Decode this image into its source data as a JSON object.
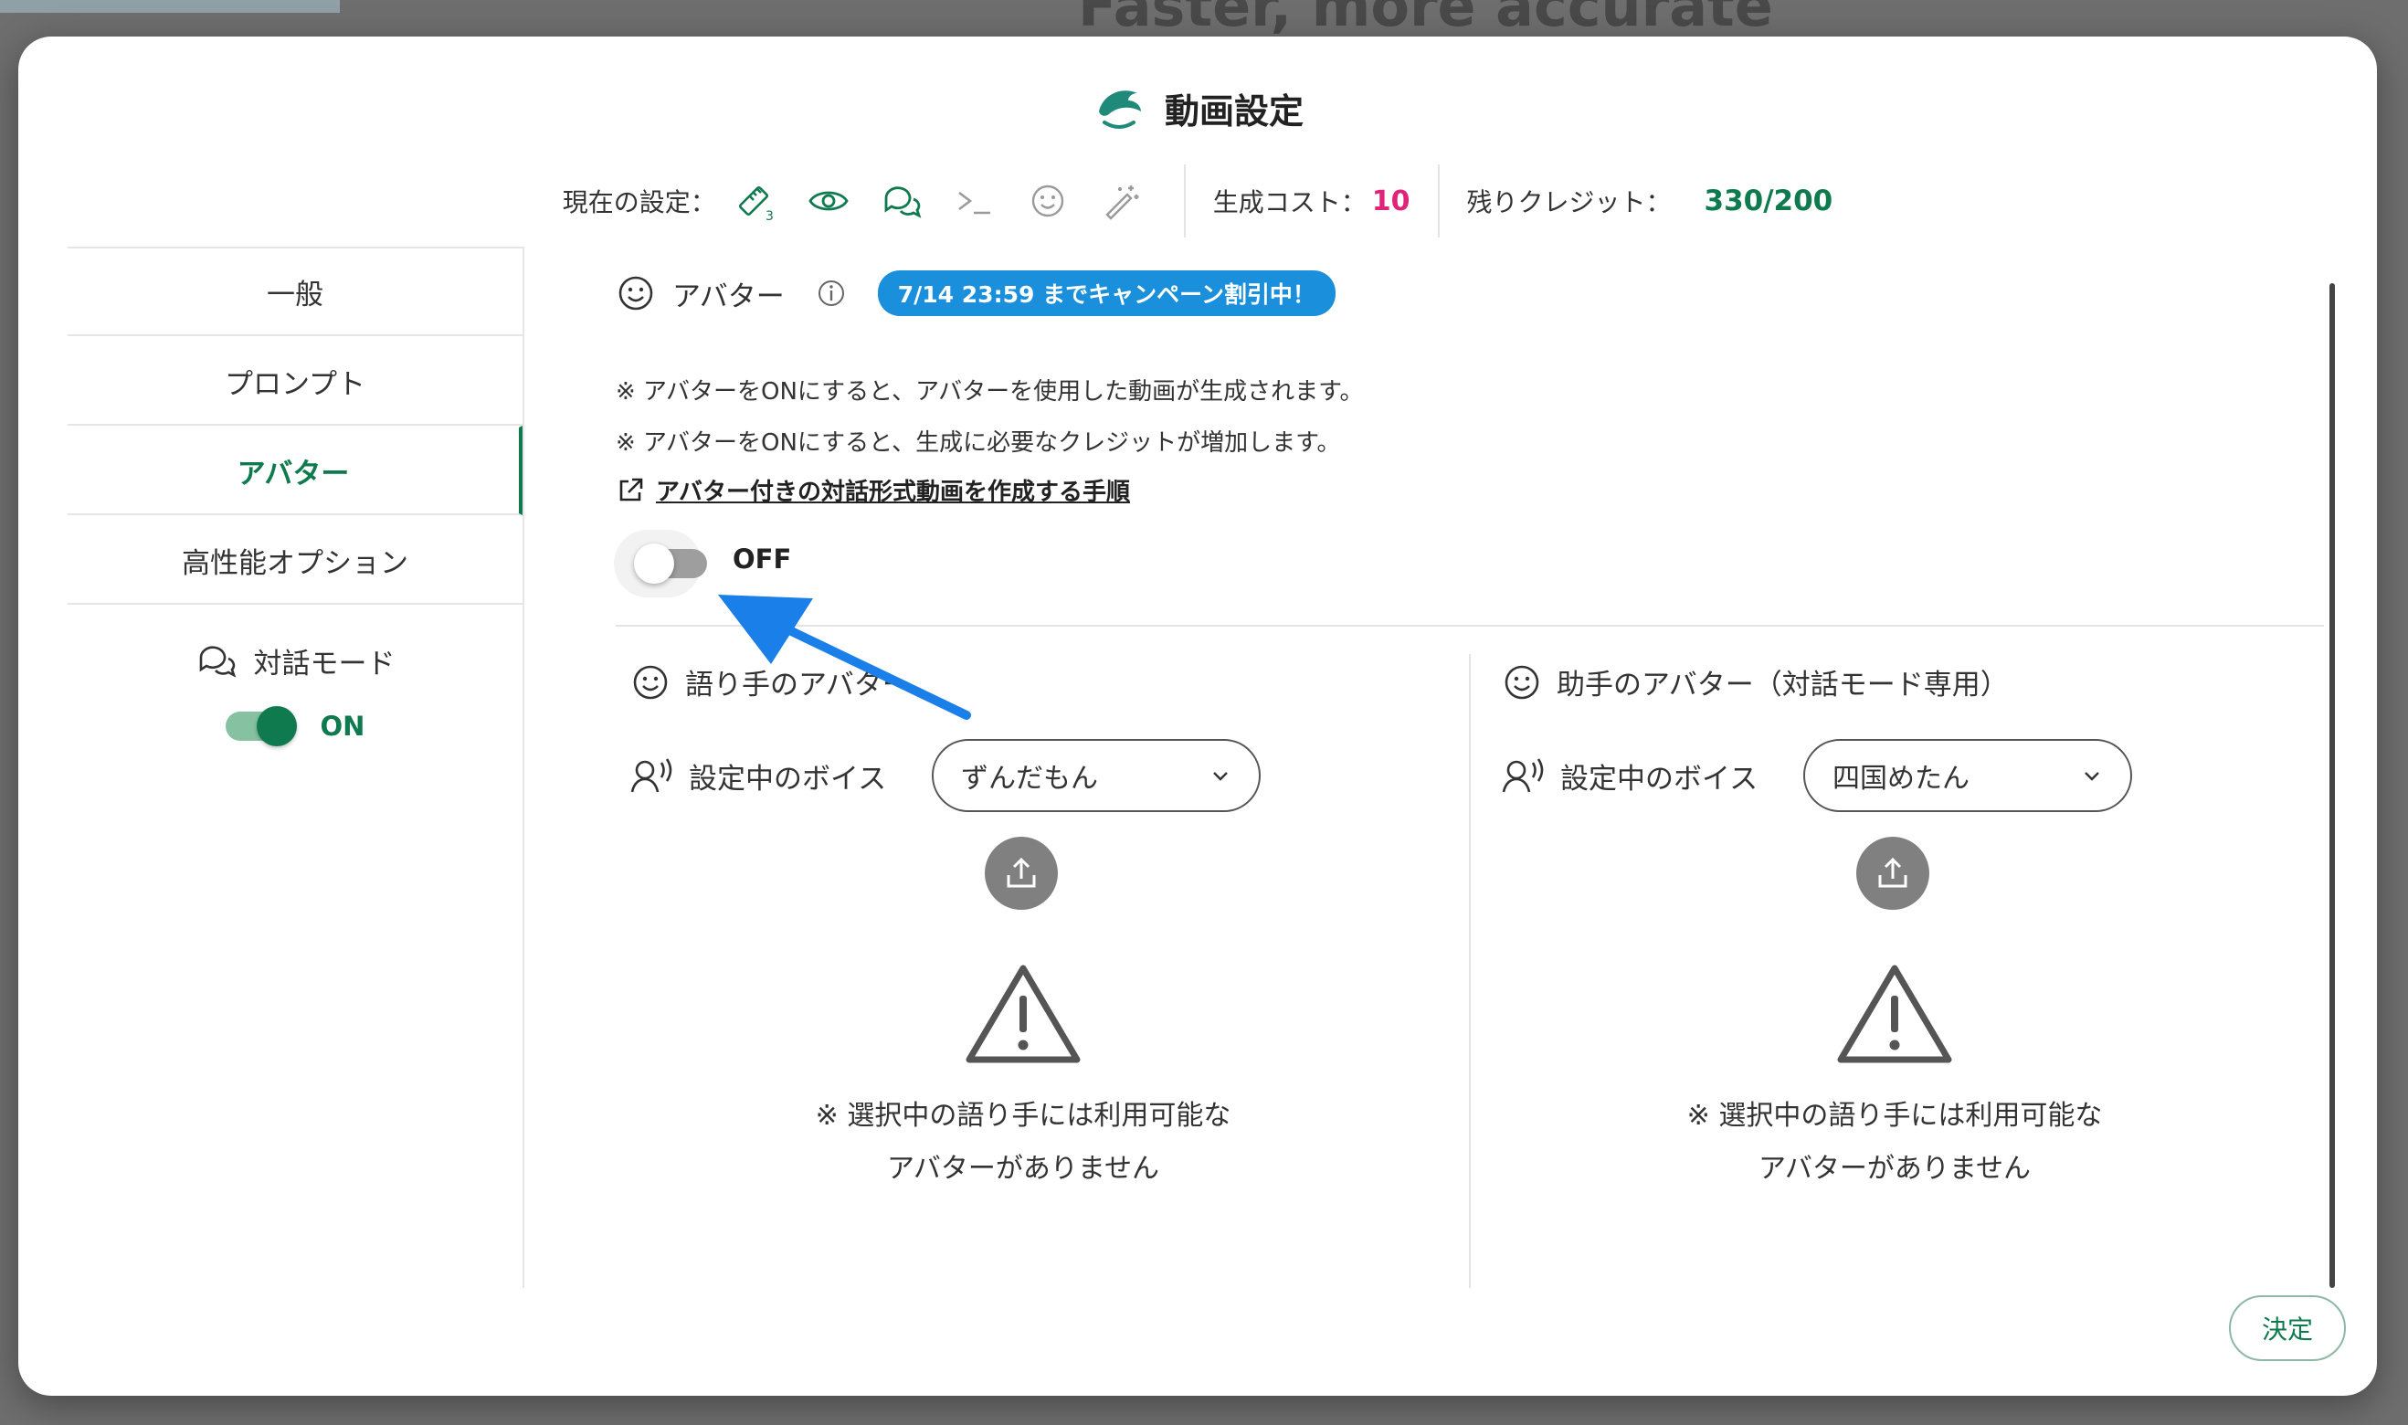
{
  "background": {
    "heading_text": "Faster, more accurate"
  },
  "header": {
    "title": "動画設定",
    "current_settings_label": "現在の設定：",
    "setting_icons": [
      "ruler-icon",
      "eye-icon",
      "chat-icon",
      "terminal-icon",
      "smiley-icon",
      "magic-wand-icon"
    ],
    "cost_label": "生成コスト：",
    "cost_value": "10",
    "credits_label": "残りクレジット：",
    "credits_value": "330/200"
  },
  "sidebar": {
    "items": [
      {
        "label": "一般",
        "active": false
      },
      {
        "label": "プロンプト",
        "active": false
      },
      {
        "label": "アバター",
        "active": true
      },
      {
        "label": "高性能オプション",
        "active": false
      }
    ],
    "dialog_mode_label": "対話モード",
    "dialog_mode_state": "ON"
  },
  "avatar": {
    "title": "アバター",
    "campaign_badge": "7/14 23:59 までキャンペーン割引中！",
    "note1": "※ アバターをONにすると、アバターを使用した動画が生成されます。",
    "note2": "※ アバターをONにすると、生成に必要なクレジットが増加します。",
    "guide_link": "アバター付きの対話形式動画を作成する手順",
    "toggle_state": "OFF"
  },
  "narrator": {
    "title": "語り手のアバター",
    "voice_label": "設定中のボイス",
    "voice_value": "ずんだもん",
    "warning_line1": "※ 選択中の語り手には利用可能な",
    "warning_line2": "アバターがありません"
  },
  "assistant": {
    "title": "助手のアバター（対話モード専用）",
    "voice_label": "設定中のボイス",
    "voice_value": "四国めたん",
    "warning_line1": "※ 選択中の語り手には利用可能な",
    "warning_line2": "アバターがありません"
  },
  "footer": {
    "confirm_label": "決定"
  },
  "colors": {
    "accent_green": "#0f7a4e",
    "cost_pink": "#e0247a",
    "badge_blue": "#1a8fdc",
    "annotation_arrow": "#1a7fe8"
  }
}
